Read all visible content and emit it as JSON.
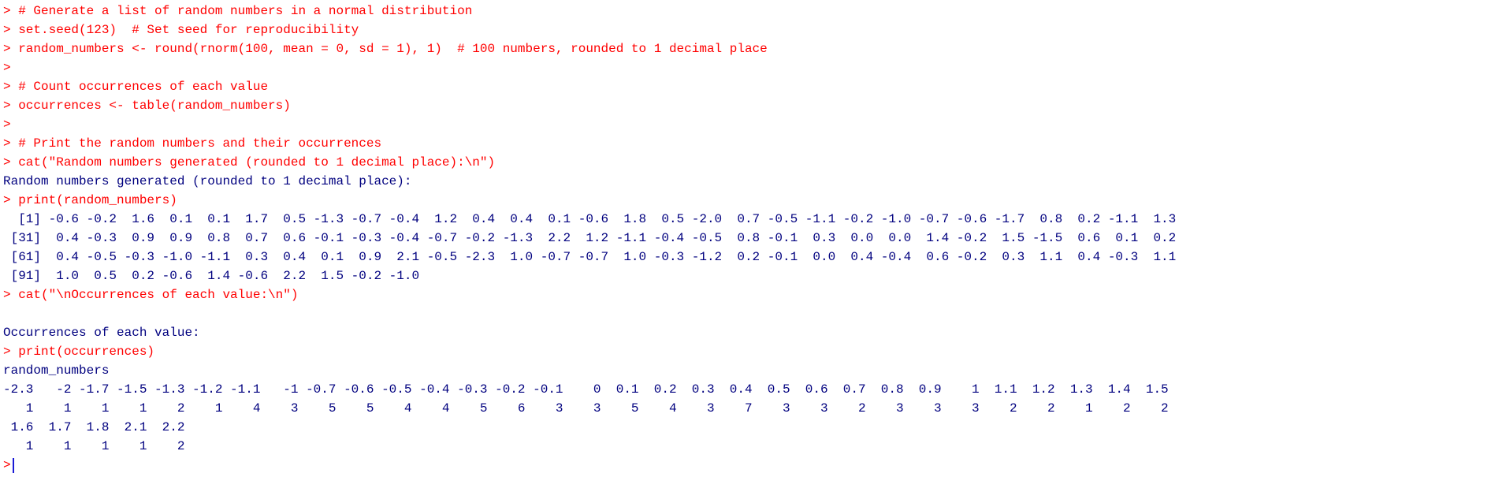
{
  "console": {
    "lines": [
      {
        "kind": "input",
        "text": "> # Generate a list of random numbers in a normal distribution"
      },
      {
        "kind": "input",
        "text": "> set.seed(123)  # Set seed for reproducibility"
      },
      {
        "kind": "input",
        "text": "> random_numbers <- round(rnorm(100, mean = 0, sd = 1), 1)  # 100 numbers, rounded to 1 decimal place"
      },
      {
        "kind": "input",
        "text": ">"
      },
      {
        "kind": "input",
        "text": "> # Count occurrences of each value"
      },
      {
        "kind": "input",
        "text": "> occurrences <- table(random_numbers)"
      },
      {
        "kind": "input",
        "text": ">"
      },
      {
        "kind": "input",
        "text": "> # Print the random numbers and their occurrences"
      },
      {
        "kind": "input",
        "text": "> cat(\"Random numbers generated (rounded to 1 decimal place):\\n\")"
      },
      {
        "kind": "output",
        "text": "Random numbers generated (rounded to 1 decimal place):"
      },
      {
        "kind": "input",
        "text": "> print(random_numbers)"
      },
      {
        "kind": "output",
        "text": "  [1] -0.6 -0.2  1.6  0.1  0.1  1.7  0.5 -1.3 -0.7 -0.4  1.2  0.4  0.4  0.1 -0.6  1.8  0.5 -2.0  0.7 -0.5 -1.1 -0.2 -1.0 -0.7 -0.6 -1.7  0.8  0.2 -1.1  1.3"
      },
      {
        "kind": "output",
        "text": " [31]  0.4 -0.3  0.9  0.9  0.8  0.7  0.6 -0.1 -0.3 -0.4 -0.7 -0.2 -1.3  2.2  1.2 -1.1 -0.4 -0.5  0.8 -0.1  0.3  0.0  0.0  1.4 -0.2  1.5 -1.5  0.6  0.1  0.2"
      },
      {
        "kind": "output",
        "text": " [61]  0.4 -0.5 -0.3 -1.0 -1.1  0.3  0.4  0.1  0.9  2.1 -0.5 -2.3  1.0 -0.7 -0.7  1.0 -0.3 -1.2  0.2 -0.1  0.0  0.4 -0.4  0.6 -0.2  0.3  1.1  0.4 -0.3  1.1"
      },
      {
        "kind": "output",
        "text": " [91]  1.0  0.5  0.2 -0.6  1.4 -0.6  2.2  1.5 -0.2 -1.0"
      },
      {
        "kind": "input",
        "text": "> cat(\"\\nOccurrences of each value:\\n\")"
      },
      {
        "kind": "output",
        "text": ""
      },
      {
        "kind": "output",
        "text": "Occurrences of each value:"
      },
      {
        "kind": "input",
        "text": "> print(occurrences)"
      },
      {
        "kind": "output",
        "text": "random_numbers"
      },
      {
        "kind": "output",
        "text": "-2.3   -2 -1.7 -1.5 -1.3 -1.2 -1.1   -1 -0.7 -0.6 -0.5 -0.4 -0.3 -0.2 -0.1    0  0.1  0.2  0.3  0.4  0.5  0.6  0.7  0.8  0.9    1  1.1  1.2  1.3  1.4  1.5"
      },
      {
        "kind": "output",
        "text": "   1    1    1    1    2    1    4    3    5    5    4    4    5    6    3    3    5    4    3    7    3    3    2    3    3    3    2    2    1    2    2"
      },
      {
        "kind": "output",
        "text": " 1.6  1.7  1.8  2.1  2.2"
      },
      {
        "kind": "output",
        "text": "   1    1    1    1    2"
      }
    ],
    "prompt": ">"
  },
  "colors": {
    "input": "#ff0000",
    "output": "#00007f",
    "background": "#ffffff",
    "cursor": "#1a1ad6"
  }
}
